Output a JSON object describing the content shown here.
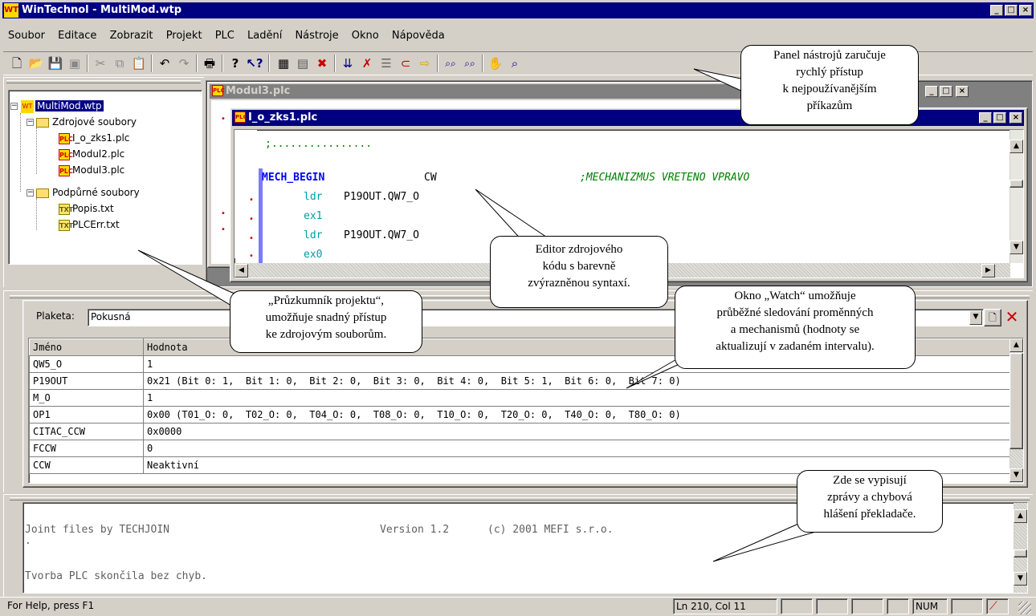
{
  "app": {
    "title": "WinTechnol - MultiMod.wtp",
    "logo": "WT"
  },
  "menu": [
    "Soubor",
    "Editace",
    "Zobrazit",
    "Projekt",
    "PLC",
    "Ladění",
    "Nástroje",
    "Okno",
    "Nápověda"
  ],
  "toolbar_icons": [
    "new-icon",
    "open-icon",
    "save-icon",
    "save-all-icon",
    "cut-icon",
    "copy-icon",
    "paste-icon",
    "undo-icon",
    "redo-icon",
    "print-icon",
    "help-icon",
    "context-help-icon",
    "compile-icon",
    "compile-all-icon",
    "stop-icon",
    "step-icon",
    "delete-icon",
    "watch-icon",
    "breakpoint-icon",
    "run-icon",
    "find-icon",
    "find-next-icon",
    "hand-icon",
    "find-replace-icon"
  ],
  "tree": {
    "root": "MultiMod.wtp",
    "source_folder": "Zdrojové soubory",
    "source_files": [
      "I_o_zks1.plc",
      "Modul2.plc",
      "Modul3.plc"
    ],
    "support_folder": "Podpůrné soubory",
    "support_files": [
      "Popis.txt",
      "PLCErr.txt"
    ]
  },
  "back_window": {
    "title": "Modul3.plc"
  },
  "editor": {
    "title": "I_o_zks1.plc",
    "lines": {
      "l1": ";................",
      "l2_kw": "MECH_BEGIN",
      "l2_arg": "CW",
      "l2_comment": ";MECHANIZMUS VRETENO VPRAVO",
      "l3_kw": "ldr",
      "l3_arg": "P19OUT.QW7_O",
      "l4_kw": "ex1",
      "l5_kw": "ldr",
      "l5_arg": "P19OUT.QW7_O",
      "l6_kw": "ex0"
    }
  },
  "watch": {
    "plaketa_label": "Plaketa:",
    "plaketa_value": "Pokusná",
    "columns": [
      "Jméno",
      "Hodnota"
    ],
    "rows": [
      {
        "name": "QW5_O",
        "value": "1"
      },
      {
        "name": "P19OUT",
        "value": "0x21 (Bit 0: 1,  Bit 1: 0,  Bit 2: 0,  Bit 3: 0,  Bit 4: 0,  Bit 5: 1,  Bit 6: 0,  Bit 7: 0)"
      },
      {
        "name": "M_O",
        "value": "1"
      },
      {
        "name": "OP1",
        "value": "0x00 (T01_O: 0,  T02_O: 0,  T04_O: 0,  T08_O: 0,  T10_O: 0,  T20_O: 0,  T40_O: 0,  T80_O: 0)"
      },
      {
        "name": "CITAC_CCW",
        "value": "0x0000"
      },
      {
        "name": "FCCW",
        "value": "0"
      },
      {
        "name": "CCW",
        "value": "Neaktivní"
      }
    ]
  },
  "output": {
    "line1": "Joint files by TECHJOIN",
    "line1_version": "Version 1.2",
    "line1_copyright": "(c) 2001 MEFI s.r.o.",
    "line2": ".",
    "line3": "Tvorba PLC skončila bez chyb."
  },
  "status": {
    "help": "For Help, press F1",
    "position": "Ln 210, Col 11",
    "num": "NUM"
  },
  "callouts": {
    "toolbar": [
      "Panel nástrojů zaručuje",
      "rychlý přístup",
      "k nejpoužívanějším",
      "příkazům"
    ],
    "editor": [
      "Editor zdrojového",
      "kódu s barevně",
      "zvýrazněnou syntaxí."
    ],
    "explorer": [
      "„Průzkumník projektu“,",
      "umožňuje snadný přístup",
      "ke zdrojovým souborům."
    ],
    "watch": [
      "Okno „Watch“ umožňuje",
      "průběžné sledování proměnných",
      "a mechanismů (hodnoty se",
      "aktualizují v zadaném intervalu)."
    ],
    "output": [
      "Zde se vypisují",
      "zprávy a chybová",
      "hlášení překladače."
    ]
  },
  "colors": {
    "title_active": "#000080",
    "title_inactive": "#808080",
    "keyword": "#0000ff",
    "instruction": "#00a0a0",
    "comment": "#008000",
    "error_red": "#cc0000"
  }
}
